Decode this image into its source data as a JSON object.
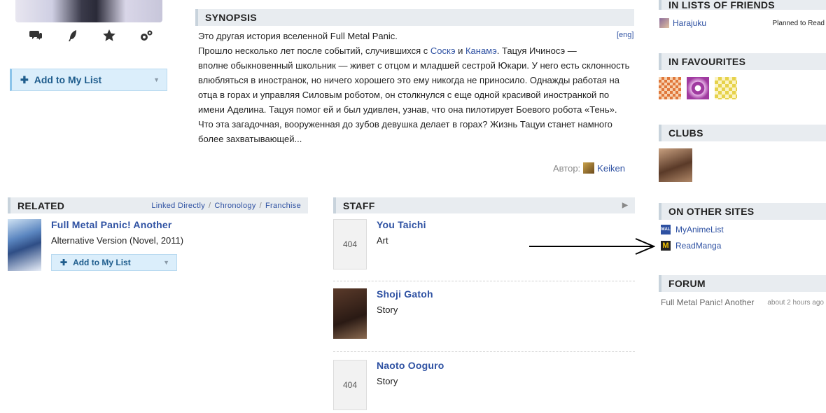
{
  "actions": {
    "icons": [
      "comments-icon",
      "feather-icon",
      "star-icon",
      "gears-icon"
    ],
    "add_to_list": "Add to My List"
  },
  "synopsis": {
    "header": "SYNOPSIS",
    "lang": "[eng]",
    "line1": "Это другая история вселенной Full Metal Panic.",
    "line2_a": "Прошло несколько лет после событий, случившихся с ",
    "link1": "Соскэ",
    "line2_b": " и ",
    "link2": "Канамэ",
    "line2_c": ". Тацуя Ичиносэ —",
    "line3": "вполне обыкновенный школьник — живет с отцом и младшей сестрой Юкари. У него есть склонность",
    "line4": "влюбляться в иностранок, но ничего хорошего это ему никогда не приносило. Однажды работая на",
    "line5": "отца в горах и управляя Силовым роботом, он столкнулся с еще одной красивой иностранкой по",
    "line6": "имени Аделина. Тацуя помог ей и был удивлен, узнав, что она пилотирует Боевого робота «Тень».",
    "line7": "Что эта загадочная, вооруженная до зубов девушка делает в горах? Жизнь Тацуи станет намного",
    "line8": "более захватывающей...",
    "author_label": "Автор:",
    "author_name": "Keiken"
  },
  "related": {
    "header": "RELATED",
    "links": [
      "Linked Directly",
      "Chronology",
      "Franchise"
    ],
    "item_title": "Full Metal Panic! Another",
    "item_sub_a": "Alternative Version",
    "item_sub_b": "(Novel,  2011)",
    "add_to_list": "Add to My List"
  },
  "staff": {
    "header": "STAFF",
    "members": [
      {
        "name": "You Taichi",
        "role": "Art"
      },
      {
        "name": "Shoji Gatoh",
        "role": "Story"
      },
      {
        "name": "Naoto Ooguro",
        "role": "Story"
      }
    ],
    "placeholder_text": "404"
  },
  "sidebar": {
    "lists_header": "IN LISTS OF FRIENDS",
    "friend_name": "Harajuku",
    "friend_status": "Planned to Read",
    "favourites_header": "IN FAVOURITES",
    "clubs_header": "CLUBS",
    "other_sites_header": "ON OTHER SITES",
    "sites": [
      "MyAnimeList",
      "ReadManga"
    ],
    "forum_header": "FORUM",
    "forum_topic": "Full Metal Panic! Another",
    "forum_time": "about 2 hours ago"
  },
  "colors": {
    "link": "#2e51a2",
    "header_bg": "#e8ecf0",
    "add_btn_bg": "#dbeefb"
  }
}
